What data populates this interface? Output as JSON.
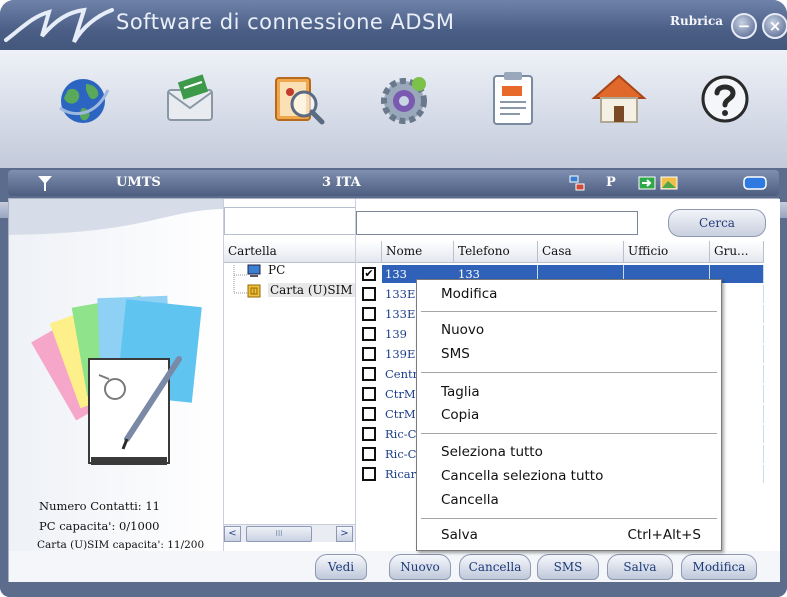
{
  "window": {
    "title": "Software di connessione ADSM",
    "section_label": "Rubrica",
    "minimize_glyph": "−",
    "close_glyph": "×"
  },
  "toolbar": {
    "buttons": [
      {
        "name": "connection",
        "icon": "globe-icon"
      },
      {
        "name": "messages",
        "icon": "envelope-icon"
      },
      {
        "name": "contacts",
        "icon": "phonebook-search-icon"
      },
      {
        "name": "settings",
        "icon": "gear-icon"
      },
      {
        "name": "log",
        "icon": "clipboard-icon"
      },
      {
        "name": "home",
        "icon": "home-icon"
      },
      {
        "name": "help",
        "icon": "question-icon"
      }
    ]
  },
  "status": {
    "network_type": "UMTS",
    "operator": "3 ITA",
    "mode_letter": "P"
  },
  "info": {
    "contacts_count": "Numero Contatti: 11",
    "pc_capacity": "PC capacita': 0/1000",
    "sim_capacity": "Carta (U)SIM capacita': 11/200"
  },
  "folders": {
    "header": "Cartella",
    "items": [
      "PC",
      "Carta (U)SIM"
    ]
  },
  "search": {
    "value": "",
    "button_label": "Cerca"
  },
  "table": {
    "columns": [
      "Nome",
      "Telefono",
      "Casa",
      "Ufficio",
      "Gru..."
    ],
    "rows": [
      {
        "nome": "133",
        "telefono": "133",
        "checked": true,
        "selected": true
      },
      {
        "nome": "133E",
        "telefono": "",
        "checked": false,
        "selected": false
      },
      {
        "nome": "133E",
        "telefono": "",
        "checked": false,
        "selected": false
      },
      {
        "nome": "139",
        "telefono": "",
        "checked": false,
        "selected": false
      },
      {
        "nome": "139E",
        "telefono": "",
        "checked": false,
        "selected": false
      },
      {
        "nome": "Centr",
        "telefono": "",
        "checked": false,
        "selected": false
      },
      {
        "nome": "CtrM",
        "telefono": "",
        "checked": false,
        "selected": false
      },
      {
        "nome": "CtrM",
        "telefono": "",
        "checked": false,
        "selected": false
      },
      {
        "nome": "Ric-C",
        "telefono": "",
        "checked": false,
        "selected": false
      },
      {
        "nome": "Ric-C",
        "telefono": "",
        "checked": false,
        "selected": false
      },
      {
        "nome": "Ricar",
        "telefono": "",
        "checked": false,
        "selected": false
      }
    ],
    "check_glyph": "✔"
  },
  "scroll": {
    "left_glyph": "<",
    "right_glyph": ">",
    "thumb_glyph": "III"
  },
  "bottom_buttons": [
    "Vedi",
    "Nuovo",
    "Cancella",
    "SMS",
    "Salva",
    "Modifica"
  ],
  "context_menu": {
    "items": [
      {
        "label": "Modifica"
      },
      {
        "label": "Nuovo"
      },
      {
        "label": "SMS"
      },
      {
        "label": "Taglia"
      },
      {
        "label": "Copia"
      },
      {
        "label": "Seleziona tutto"
      },
      {
        "label": "Cancella seleziona tutto"
      },
      {
        "label": "Cancella"
      },
      {
        "label": "Salva",
        "shortcut": "Ctrl+Alt+S"
      }
    ]
  },
  "colors": {
    "accent": "#2f61b8",
    "frame": "#5b6c8c",
    "link_text": "#1d3f8a"
  }
}
